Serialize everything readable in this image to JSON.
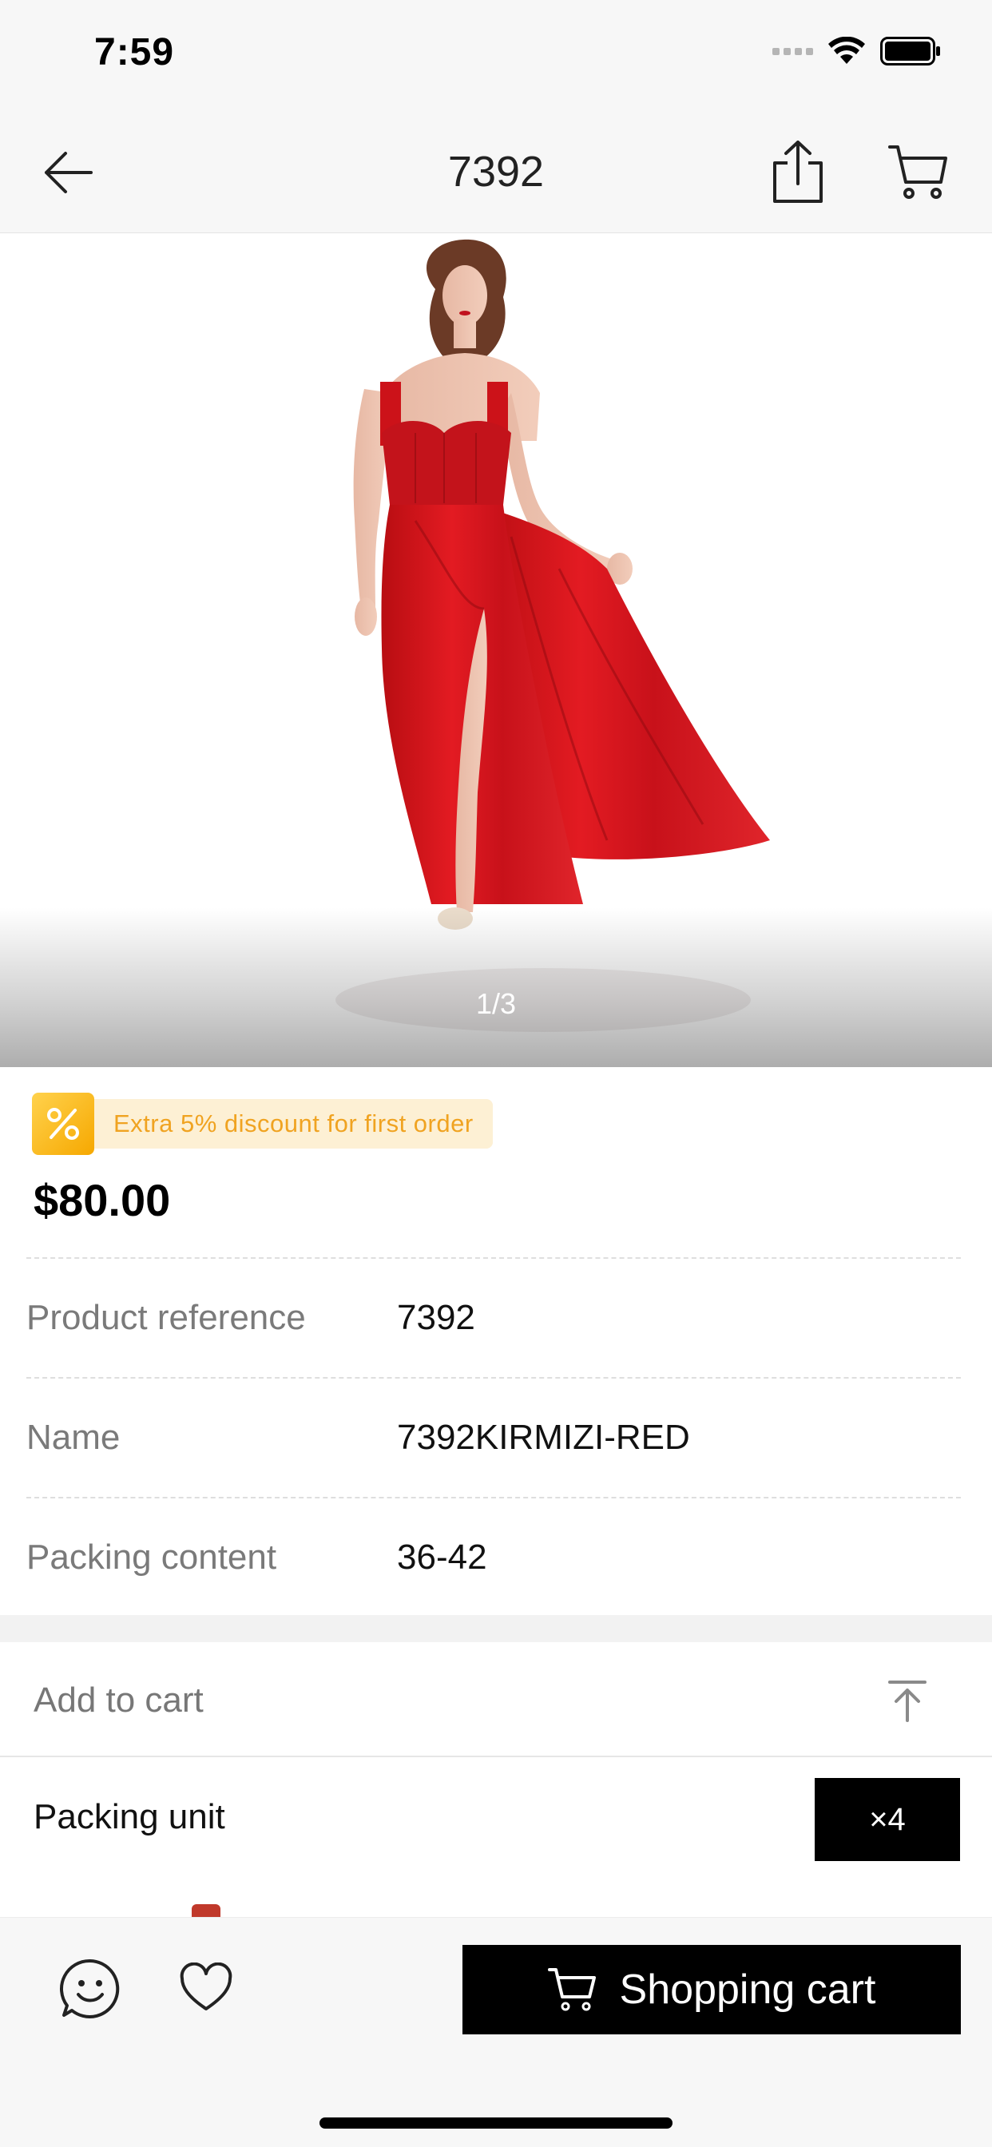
{
  "status_bar": {
    "time": "7:59"
  },
  "nav": {
    "title": "7392"
  },
  "gallery": {
    "indicator": "1/3"
  },
  "promo": {
    "text": "Extra 5% discount for first order"
  },
  "price": "$80.00",
  "attributes": [
    {
      "key": "Product reference",
      "value": "7392"
    },
    {
      "key": "Name",
      "value": "7392KIRMIZI-RED"
    },
    {
      "key": "Packing content",
      "value": "36-42"
    }
  ],
  "add_to_cart": {
    "label": "Add to cart"
  },
  "packing_unit": {
    "label": "Packing unit",
    "value": "×4"
  },
  "bottom_bar": {
    "cart_button_label": "Shopping cart"
  },
  "colors": {
    "dress_red": "#d8141b",
    "promo_accent": "#f0a321",
    "primary_button": "#000000"
  }
}
